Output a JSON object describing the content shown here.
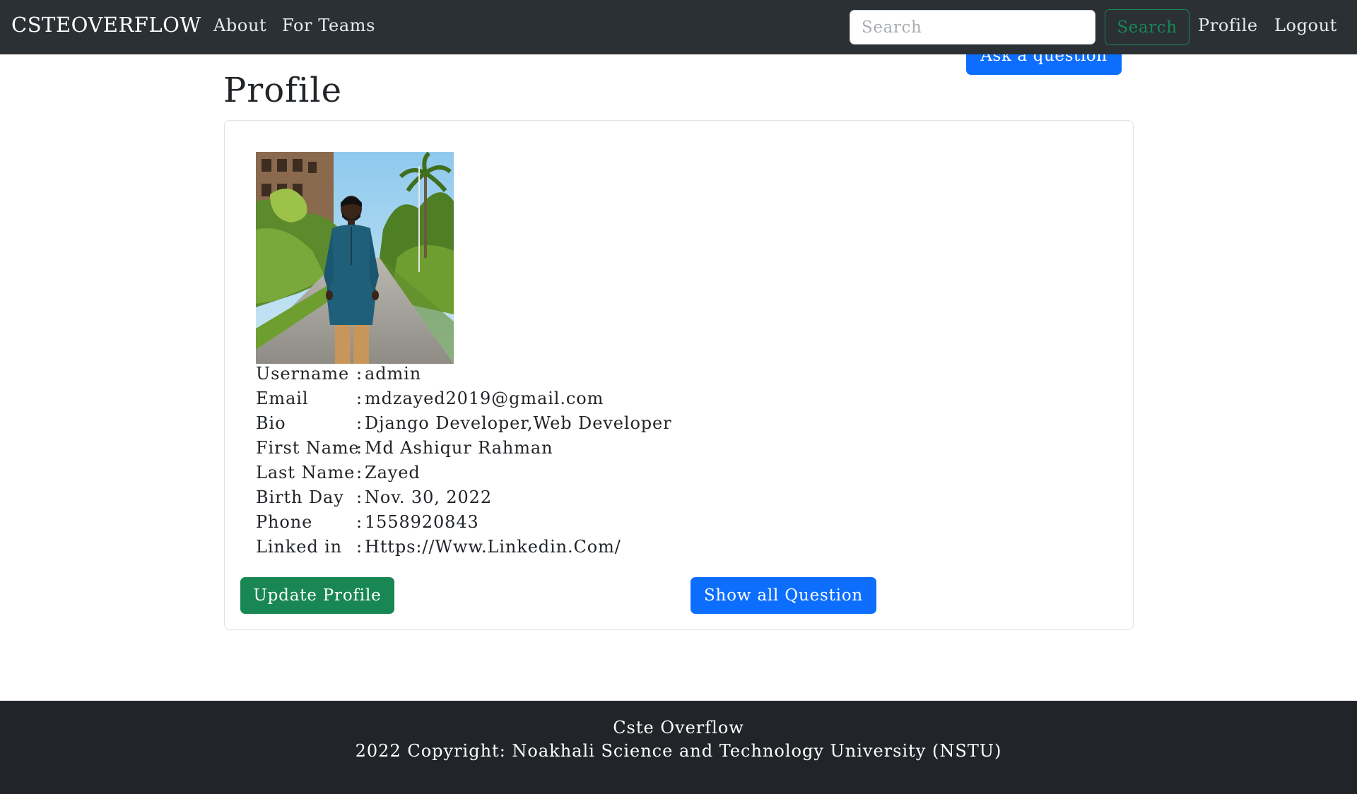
{
  "navbar": {
    "brand": "CSTEOVERFLOW",
    "links": [
      "About",
      "For Teams"
    ],
    "search_placeholder": "Search",
    "search_value": "",
    "search_button": "Search",
    "profile": "Profile",
    "logout": "Logout"
  },
  "ask_button": "Ask a question",
  "page_title": "Profile",
  "profile": {
    "fields": [
      {
        "label": "Username",
        "value": "admin"
      },
      {
        "label": "Email",
        "value": "mdzayed2019@gmail.com"
      },
      {
        "label": "Bio",
        "value": "Django Developer,Web Developer"
      },
      {
        "label": "First Name",
        "value": "Md Ashiqur Rahman"
      },
      {
        "label": "Last Name",
        "value": "Zayed"
      },
      {
        "label": "Birth Day",
        "value": "Nov. 30, 2022"
      },
      {
        "label": "Phone",
        "value": "1558920843"
      },
      {
        "label": "Linked in",
        "value": "Https://Www.Linkedin.Com/"
      }
    ],
    "separator": ":",
    "update_button": "Update Profile",
    "show_button": "Show all Question"
  },
  "footer": {
    "line1": "Cste Overflow",
    "line2": "2022 Copyright: Noakhali Science and Technology University (NSTU)"
  },
  "colors": {
    "navbar_bg": "#2b3035",
    "primary": "#0d6efd",
    "success": "#198754",
    "footer_bg": "#212529"
  }
}
